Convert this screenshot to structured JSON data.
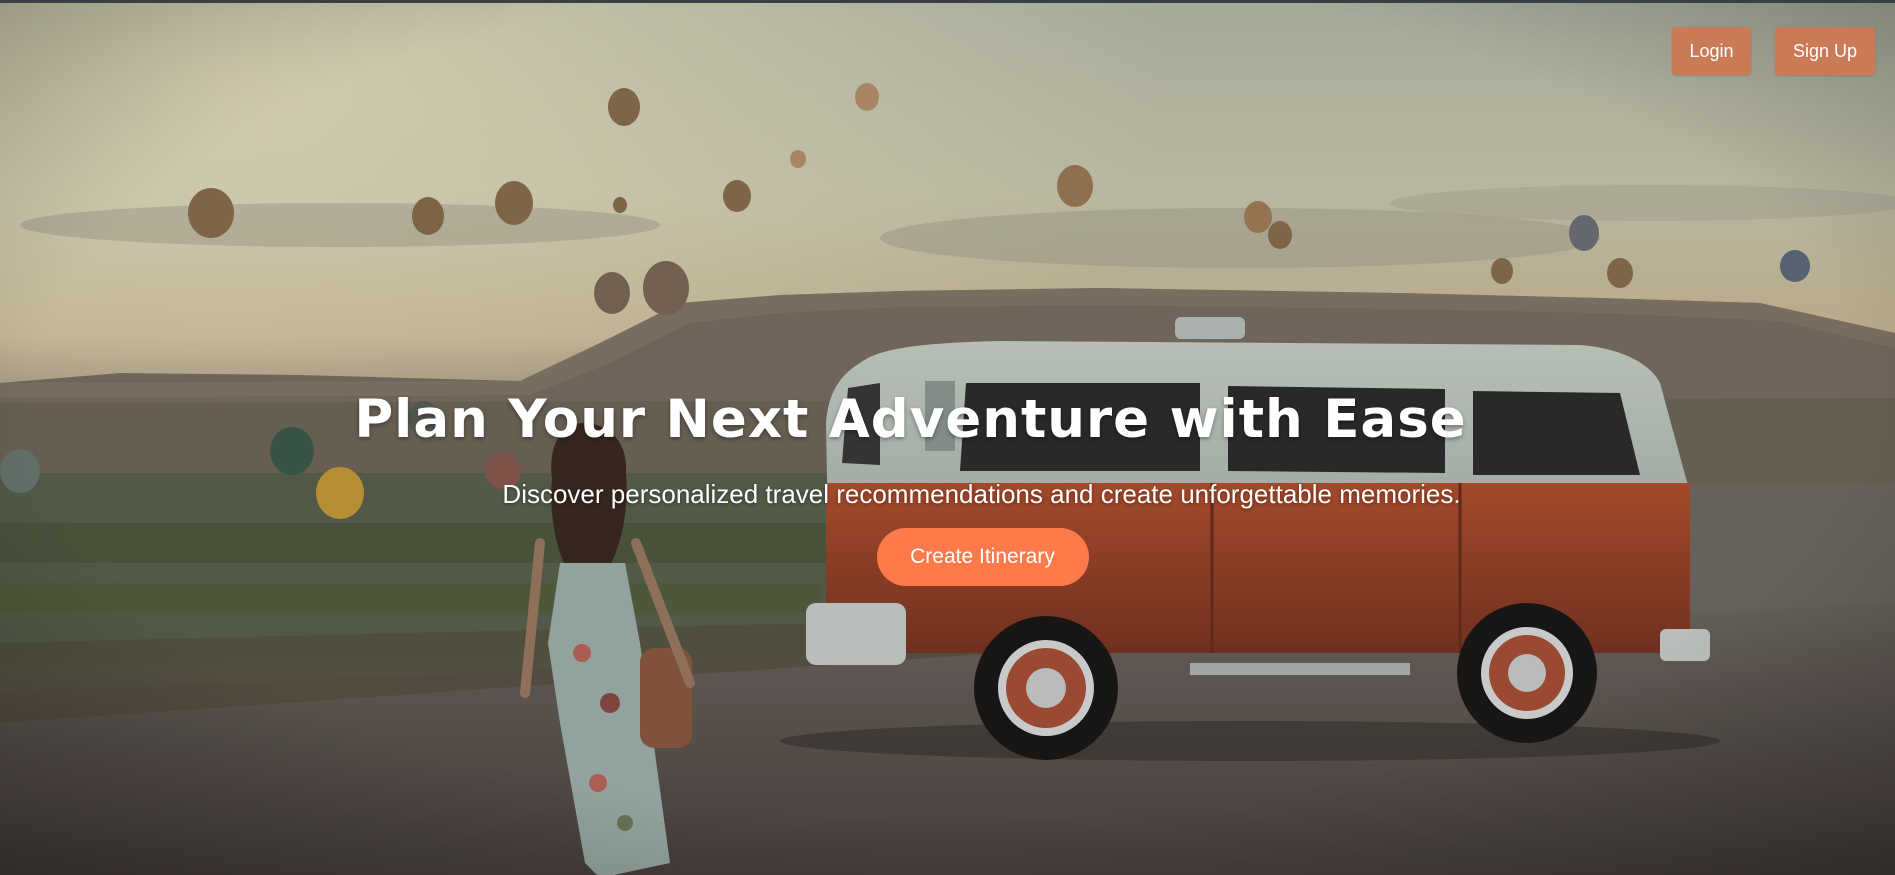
{
  "nav": {
    "login_label": "Login",
    "signup_label": "Sign Up"
  },
  "hero": {
    "title": "Plan Your Next Adventure with Ease",
    "subtitle": "Discover personalized travel recommendations and create unforgettable memories.",
    "cta_label": "Create Itinerary"
  },
  "colors": {
    "nav_button": "#c97a57",
    "cta_button": "#ff7a4b",
    "text": "#ffffff"
  }
}
